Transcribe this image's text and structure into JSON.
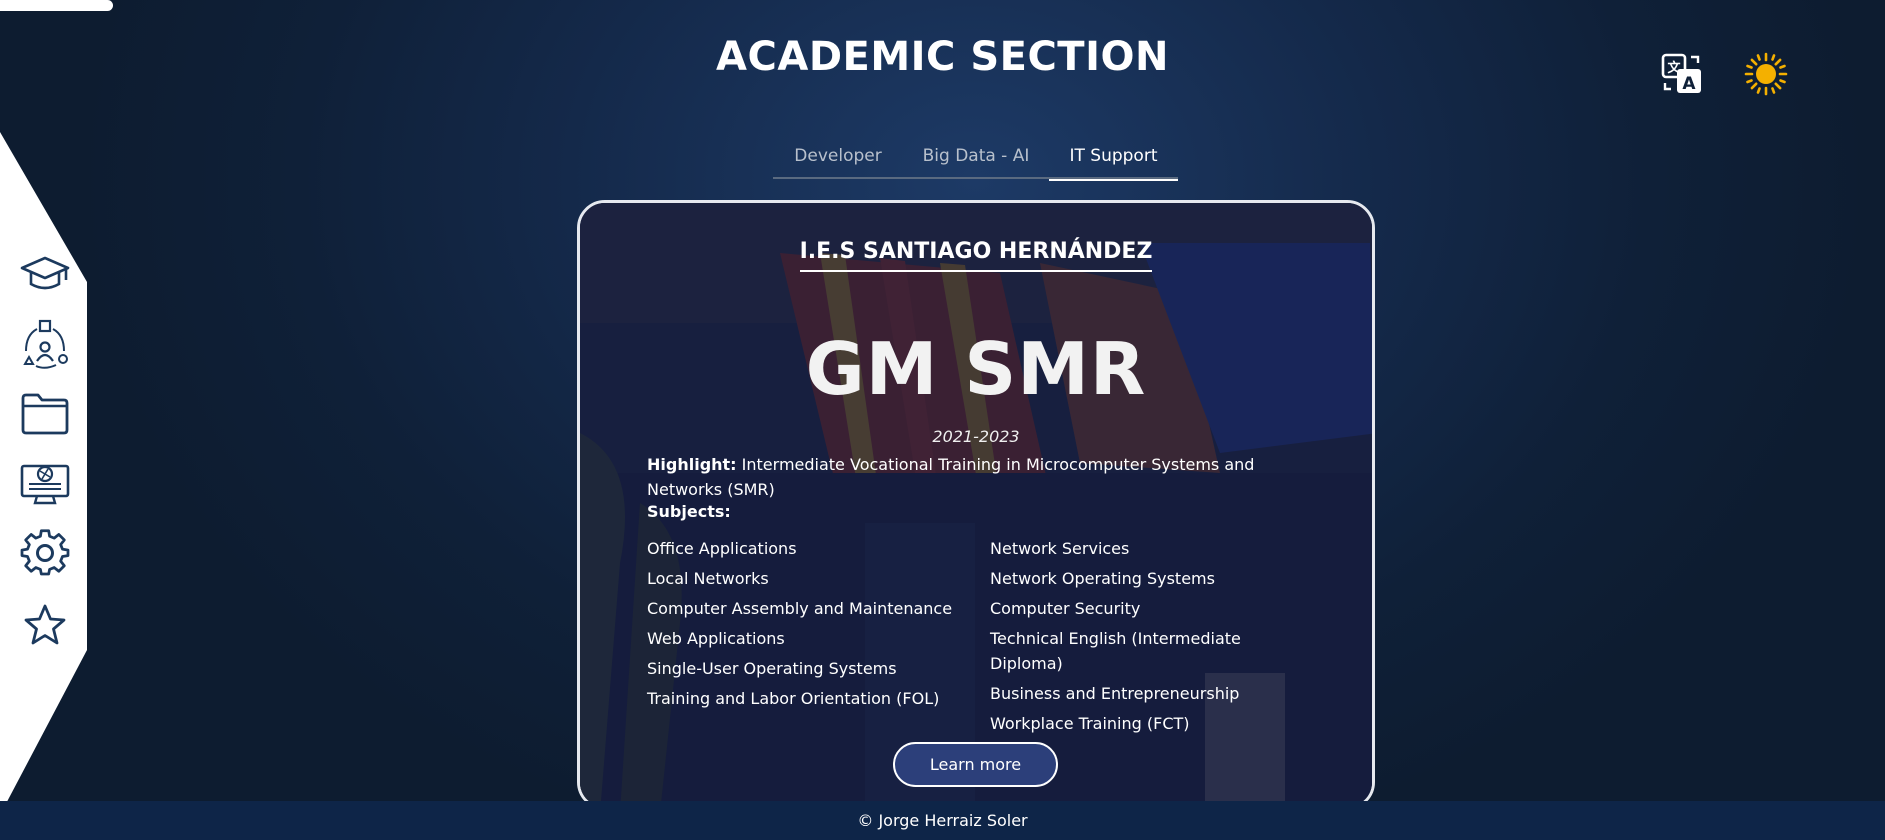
{
  "page": {
    "title": "ACADEMIC SECTION"
  },
  "progress": {
    "value": 0.06
  },
  "top_icons": [
    "translate-icon",
    "sun-icon"
  ],
  "colors": {
    "accent": "#2c3f7a",
    "icon_navy": "#1c3a5e",
    "sun": "#f4b000"
  },
  "sidebar": {
    "items": [
      {
        "icon": "graduation-cap-icon"
      },
      {
        "icon": "team-network-icon"
      },
      {
        "icon": "folder-icon"
      },
      {
        "icon": "computer-monitor-icon"
      },
      {
        "icon": "gear-icon"
      },
      {
        "icon": "star-icon"
      }
    ]
  },
  "tabs": [
    {
      "label": "Developer",
      "active": false
    },
    {
      "label": "Big Data - AI",
      "active": false
    },
    {
      "label": "IT Support",
      "active": true
    }
  ],
  "card": {
    "school": "I.E.S SANTIAGO HERNÁNDEZ",
    "degree": "GM SMR",
    "years": "2021-2023",
    "highlight_label": "Highlight:",
    "highlight_text": "Intermediate Vocational Training in Microcomputer Systems and Networks (SMR)",
    "subjects_label": "Subjects:",
    "subjects_left": [
      "Office Applications",
      "Local Networks",
      "Computer Assembly and Maintenance",
      "Web Applications",
      "Single-User Operating Systems",
      "Training and Labor Orientation (FOL)"
    ],
    "subjects_right": [
      "Network Services",
      "Network Operating Systems",
      "Computer Security",
      "Technical English (Intermediate Diploma)",
      "Business and Entrepreneurship",
      "Workplace Training (FCT)"
    ],
    "button_label": "Learn more"
  },
  "footer": {
    "text": "© Jorge Herraiz Soler"
  }
}
